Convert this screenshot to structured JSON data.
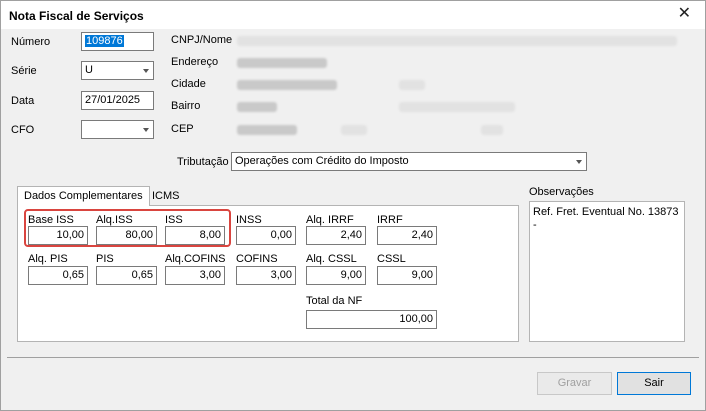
{
  "window": {
    "title": "Nota Fiscal de Serviços",
    "close_glyph": "✕"
  },
  "header": {
    "numero": {
      "label": "Número",
      "value": "109876"
    },
    "serie": {
      "label": "Série",
      "value": "U"
    },
    "data": {
      "label": "Data",
      "value": "27/01/2025"
    },
    "cfo": {
      "label": "CFO",
      "value": ""
    },
    "cnpj_label": "CNPJ/Nome",
    "endereco_label": "Endereço",
    "cidade_label": "Cidade",
    "bairro_label": "Bairro",
    "cep_label": "CEP"
  },
  "tributacao": {
    "label": "Tributação",
    "value": "Operações com Crédito do Imposto"
  },
  "tabs": [
    {
      "label": "Dados Complementares"
    },
    {
      "label": "ICMS"
    }
  ],
  "fields": {
    "base_iss": {
      "label": "Base ISS",
      "value": "10,00"
    },
    "aliq_iss": {
      "label": "Alq.ISS",
      "value": "80,00"
    },
    "iss": {
      "label": "ISS",
      "value": "8,00"
    },
    "inss": {
      "label": "INSS",
      "value": "0,00"
    },
    "aliq_irrf": {
      "label": "Alq. IRRF",
      "value": "2,40"
    },
    "irrf": {
      "label": "IRRF",
      "value": "2,40"
    },
    "aliq_pis": {
      "label": "Alq. PIS",
      "value": "0,65"
    },
    "pis": {
      "label": "PIS",
      "value": "0,65"
    },
    "aliq_cofins": {
      "label": "Alq.COFINS",
      "value": "3,00"
    },
    "cofins": {
      "label": "COFINS",
      "value": "3,00"
    },
    "aliq_cssl": {
      "label": "Alq. CSSL",
      "value": "9,00"
    },
    "cssl": {
      "label": "CSSL",
      "value": "9,00"
    },
    "total_nf": {
      "label": "Total da NF",
      "value": "100,00"
    }
  },
  "observacoes": {
    "label": "Observações",
    "line1": "Ref. Fret. Eventual No. 13873",
    "line2": "-"
  },
  "buttons": {
    "gravar": "Gravar",
    "sair": "Sair"
  },
  "colors": {
    "highlight": "#d9453f",
    "selection": "#0078d7"
  }
}
